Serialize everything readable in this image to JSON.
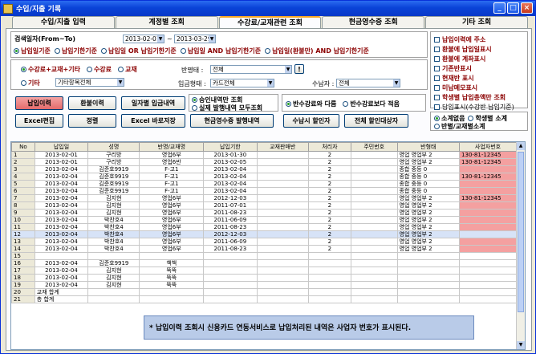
{
  "window": {
    "title": "수입/지출 기록"
  },
  "tabs": [
    "수입/지출 입력",
    "계정별 조회",
    "수강료/교재관련 조회",
    "현금영수증 조회",
    "기타 조회"
  ],
  "search": {
    "period_label": "검색일자(From~To)",
    "date_from": "2013-02-01",
    "date_to": "2013-03-29",
    "basis_options": [
      "납입일기준",
      "납입기한기준",
      "납입일 OR 납입기한기준",
      "납입일 AND 납입기한기준",
      "납입일(환불만) AND 납입기한기준"
    ],
    "type_options": [
      "수강료+교재+기타",
      "수강료",
      "교재",
      "기타"
    ],
    "etc_value": "기타항목전체",
    "class_label": "반명태 :",
    "class_value": "전체",
    "class_button": "!",
    "payment_label": "입금형태 :",
    "payment_value": "카드전체",
    "receiver_label": "수납자 :",
    "receiver_value": "전체"
  },
  "buttons": {
    "payment_history": "납입이력",
    "refund_history": "환불이력",
    "daily_cash": "일자별 입금내역",
    "excel_edit": "Excel편집",
    "sort": "정렬",
    "excel_save": "Excel 바로저장",
    "cash_receipt": "현금영수증 발행내역",
    "receiver_discount": "수납시 할인자",
    "all_discount": "전체 할인대상자"
  },
  "view_options": [
    "승인내역만 조회",
    "실제 발행내역 모두조회"
  ],
  "compare_options": [
    "반수강료와 다름",
    "반수강료보다 적음"
  ],
  "side_checks": [
    "납입이력에 주소",
    "환불에 납입일표시",
    "환불에 계좌표시",
    "기존반표시",
    "현재반 표시",
    "미납메모표시",
    "학생별 납입총액만 조회",
    "담임표시(수강반 납입기준)"
  ],
  "subtotal_options": [
    "소계없음",
    "학생별 소계",
    "반별/교재별소계"
  ],
  "table": {
    "headers": [
      "No",
      "납입일",
      "성명",
      "반명/교재명",
      "납입기한",
      "교재판매반",
      "처리자",
      "주민번호",
      "반형태",
      "사업자번호"
    ],
    "rows": [
      [
        "1",
        "2013-02-01",
        "구리방",
        "영업6부",
        "2013-01-30",
        "",
        "2",
        "",
        "영업 영업부 2",
        "130-81-12345"
      ],
      [
        "2",
        "2013-02-01",
        "구리방",
        "영업6반",
        "2013-02-05",
        "",
        "2",
        "",
        "영업 영업부 2",
        "130-81-12345"
      ],
      [
        "3",
        "2013-02-04",
        "김준호9919",
        "F-고1",
        "2013-02-04",
        "",
        "2",
        "",
        "종합 중등 0",
        ""
      ],
      [
        "4",
        "2013-02-04",
        "김준호9919",
        "F-고1",
        "2013-02-04",
        "",
        "2",
        "",
        "종합 중등 0",
        "130-81-12345"
      ],
      [
        "5",
        "2013-02-04",
        "김준호9919",
        "F-고1",
        "2013-02-04",
        "",
        "2",
        "",
        "종합 중등 0",
        ""
      ],
      [
        "6",
        "2013-02-04",
        "김준호9919",
        "F-고1",
        "2013-02-04",
        "",
        "2",
        "",
        "종합 중등 0",
        ""
      ],
      [
        "7",
        "2013-02-04",
        "김지현",
        "영업6부",
        "2012-12-03",
        "",
        "2",
        "",
        "영업 영업부 2",
        "130-81-12345"
      ],
      [
        "8",
        "2013-02-04",
        "김지현",
        "영업6부",
        "2011-07-01",
        "",
        "2",
        "",
        "영업 영업부 2",
        ""
      ],
      [
        "9",
        "2013-02-04",
        "김지현",
        "영업6부",
        "2011-08-23",
        "",
        "2",
        "",
        "영업 영업부 2",
        ""
      ],
      [
        "10",
        "2013-02-04",
        "박찬호4",
        "영업6부",
        "2011-06-09",
        "",
        "2",
        "",
        "영업 영업부 2",
        ""
      ],
      [
        "11",
        "2013-02-04",
        "박찬호4",
        "영업6부",
        "2011-08-23",
        "",
        "2",
        "",
        "영업 영업부 2",
        ""
      ],
      [
        "12",
        "2013-02-04",
        "박찬호4",
        "영업6부",
        "2012-12-03",
        "",
        "2",
        "",
        "영업 영업부 2",
        ""
      ],
      [
        "13",
        "2013-02-04",
        "박찬호4",
        "영업6부",
        "2011-06-09",
        "",
        "2",
        "",
        "영업 영업부 2",
        ""
      ],
      [
        "14",
        "2013-02-04",
        "박찬호4",
        "영업6부",
        "2011-08-23",
        "",
        "2",
        "",
        "영업 영업부 2",
        ""
      ],
      [
        "15",
        "",
        "",
        "",
        "",
        "",
        "",
        "",
        "",
        ""
      ],
      [
        "16",
        "2013-02-04",
        "김준호9919",
        "책책",
        "",
        "",
        "",
        "",
        "",
        ""
      ],
      [
        "17",
        "2013-02-04",
        "김지현",
        "뚝뚝",
        "",
        "",
        "",
        "",
        "",
        ""
      ],
      [
        "18",
        "2013-02-04",
        "김지현",
        "뚝뚝",
        "",
        "",
        "",
        "",
        "",
        ""
      ],
      [
        "19",
        "2013-02-04",
        "김지현",
        "뚝뚝",
        "",
        "",
        "",
        "",
        "",
        ""
      ],
      [
        "20",
        "교재 합계",
        "",
        "",
        "",
        "",
        "",
        "",
        "",
        ""
      ],
      [
        "21",
        "총 합계",
        "",
        "",
        "",
        "",
        "",
        "",
        "",
        ""
      ]
    ]
  },
  "tooltip": "* 납입이력 조회시 신용카드 연동서비스로 납입처리된 내역은 사업자 번호가 표시된다."
}
